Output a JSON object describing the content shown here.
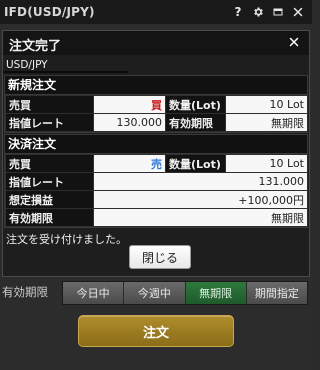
{
  "window": {
    "title": "IFD(USD/JPY)",
    "icons": [
      "help-icon",
      "gear-icon",
      "window-icon",
      "close-icon"
    ]
  },
  "dialog": {
    "title": "注文完了",
    "pair": "USD/JPY",
    "new_order": {
      "title": "新規注文",
      "rows": [
        [
          "売買",
          "買",
          "数量(Lot)",
          "10 Lot"
        ],
        [
          "指値レート",
          "130.000",
          "有効期限",
          "無期限"
        ]
      ]
    },
    "settle_order": {
      "title": "決済注文",
      "rows": [
        [
          "売買",
          "売",
          "数量(Lot)",
          "10 Lot"
        ],
        [
          "指値レート",
          "131.000"
        ],
        [
          "想定損益",
          "+100,000円"
        ],
        [
          "有効期限",
          "無期限"
        ]
      ]
    },
    "message": "注文を受け付けました。",
    "close_button": "閉じる"
  },
  "bottom": {
    "expiry_label": "有効期限",
    "expiry_options": [
      "今日中",
      "今週中",
      "無期限",
      "期間指定"
    ],
    "expiry_selected": "無期限",
    "order_button": "注文"
  },
  "colors": {
    "buy": "#c81e1e",
    "sell": "#2f7ed8",
    "active_segment": "#2d7a3d",
    "order_button": "#a0801f"
  }
}
